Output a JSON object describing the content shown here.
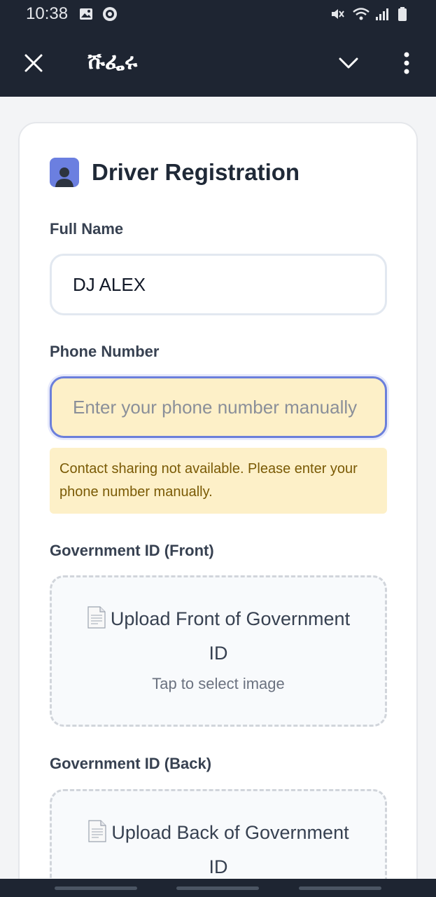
{
  "status_bar": {
    "time": "10:38",
    "icons": [
      "image-icon",
      "whatsapp-icon",
      "mute-icon",
      "wifi-icon",
      "signal-icon",
      "battery-icon"
    ]
  },
  "app_bar": {
    "title": "ሹፌሩ",
    "icons": [
      "close-icon",
      "chevron-down-icon",
      "more-vert-icon"
    ]
  },
  "form": {
    "title": "Driver Registration",
    "full_name": {
      "label": "Full Name",
      "value": "DJ ALEX"
    },
    "phone": {
      "label": "Phone Number",
      "value": "",
      "placeholder": "Enter your phone number manually"
    },
    "warning": "Contact sharing not available. Please enter your phone number manually.",
    "id_front": {
      "label": "Government ID (Front)",
      "title": "Upload Front of Government ID",
      "subtitle": "Tap to select image"
    },
    "id_back": {
      "label": "Government ID (Back)",
      "title": "Upload Back of Government ID"
    }
  },
  "colors": {
    "app_bar": "#1e2532",
    "accent": "#6b7fe0",
    "warning_bg": "#fdf0c8",
    "warning_text": "#7a5a05"
  }
}
